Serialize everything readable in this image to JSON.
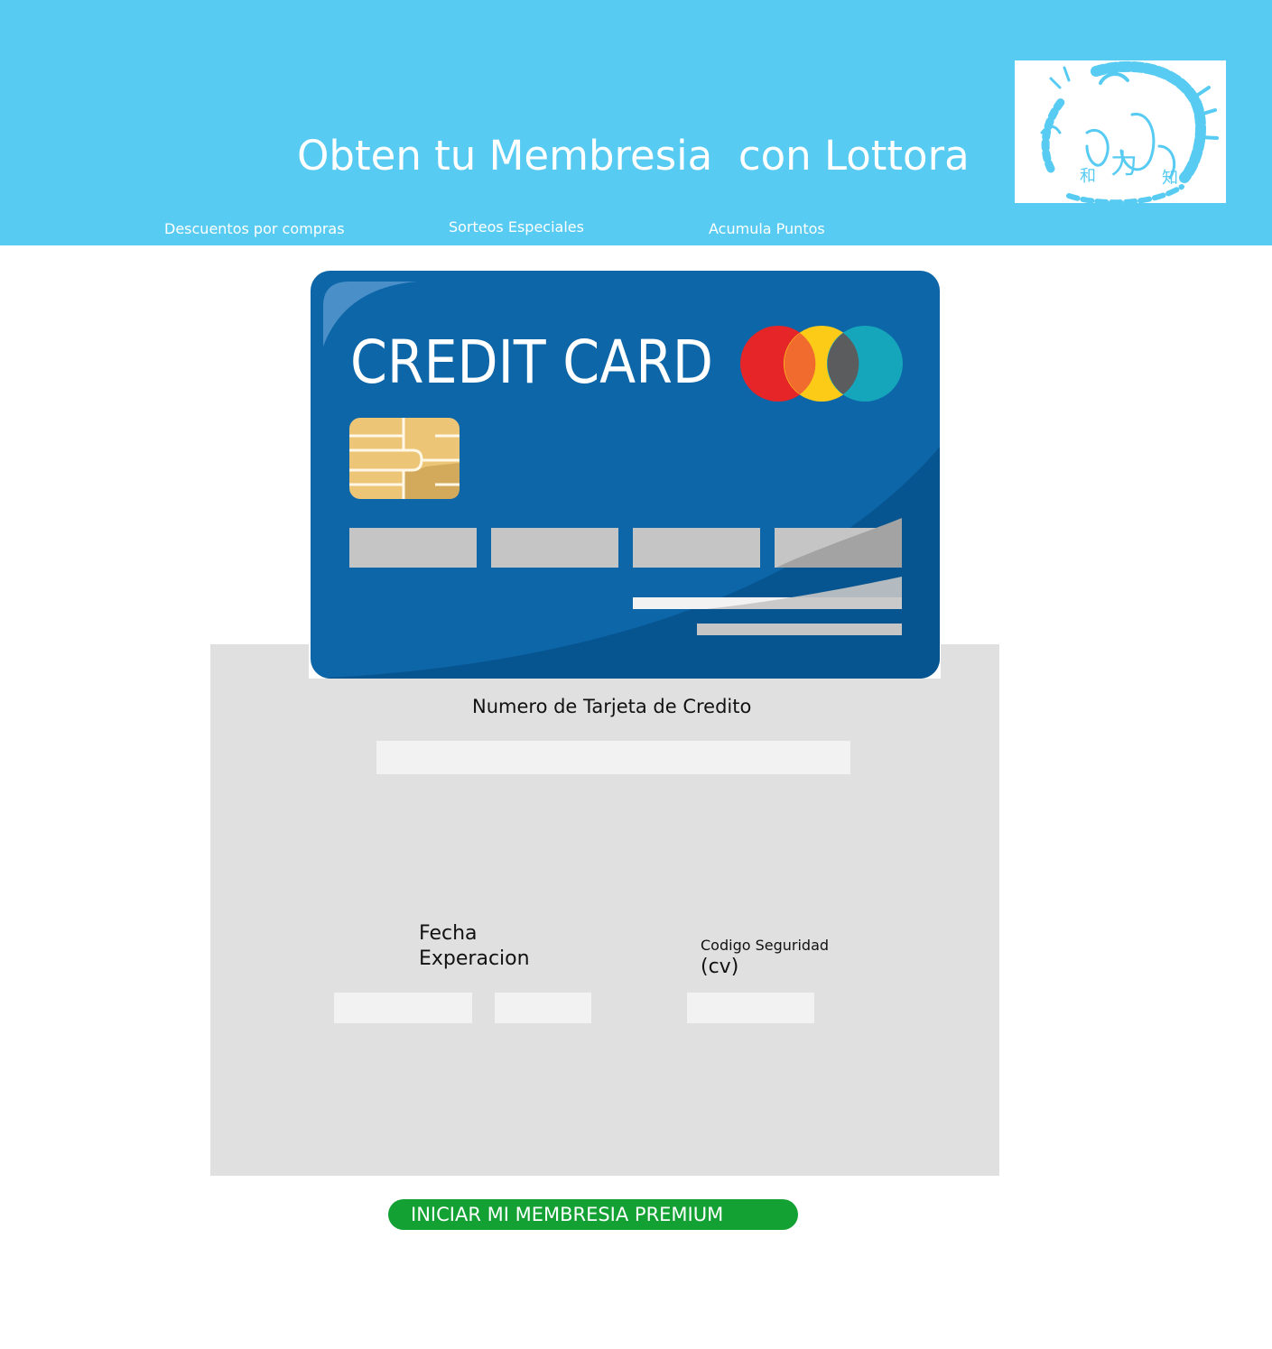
{
  "header": {
    "title": "Obten tu Membresia  con Lottora",
    "logo": {
      "icon": "tiger-circle-logo-icon",
      "kanji": [
        "和",
        "力",
        "知"
      ]
    },
    "nav": [
      {
        "label": "Descuentos por compras"
      },
      {
        "label": "Sorteos Especiales"
      },
      {
        "label": "Acumula Puntos"
      }
    ]
  },
  "card_image": {
    "icon": "credit-card-illustration-icon",
    "label": "CREDIT CARD"
  },
  "form": {
    "card_number_label": "Numero de Tarjeta de Credito",
    "expiry_label_line1": "Fecha",
    "expiry_label_line2": "Experacion",
    "cvv_label_line1": "Codigo Seguridad",
    "cvv_label_line2": "(cv)",
    "card_number_value": "",
    "expiry_month_value": "",
    "expiry_year_value": "",
    "cvv_value": ""
  },
  "cta": {
    "label": "INICIAR MI MEMBRESIA PREMIUM"
  },
  "colors": {
    "header_bg": "#57cbf2",
    "panel_bg": "#e0e0e0",
    "card_blue": "#0c66a8",
    "button_green": "#12a132"
  }
}
